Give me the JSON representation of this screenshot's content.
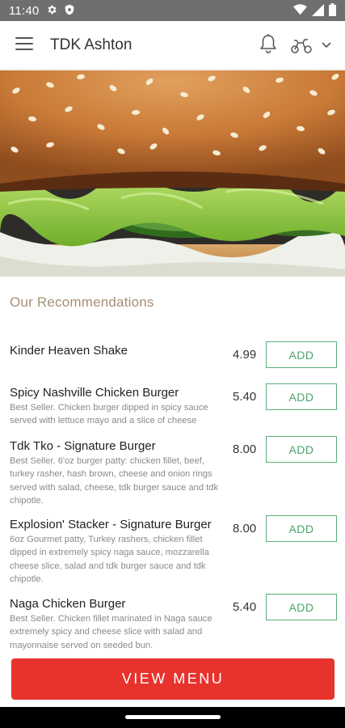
{
  "status_bar": {
    "time": "11:40",
    "icons": [
      "gear-icon",
      "shield-icon",
      "wifi-icon",
      "signal-icon",
      "battery-icon"
    ]
  },
  "app_bar": {
    "title": "TDK Ashton",
    "icons": [
      "menu-icon",
      "bell-icon",
      "scooter-icon",
      "chevron-down-icon"
    ]
  },
  "hero": {
    "image": "burger-photo"
  },
  "recommendations": {
    "title": "Our Recommendations",
    "add_label": "ADD",
    "items": [
      {
        "name": "Kinder Heaven Shake",
        "description": "",
        "price": "4.99"
      },
      {
        "name": "Spicy Nashville Chicken Burger",
        "description": "Best Seller. Chicken burger dipped in spicy sauce served with lettuce mayo and a slice of cheese",
        "price": "5.40"
      },
      {
        "name": "Tdk Tko - Signature Burger",
        "description": "Best Seller. 6'oz burger patty: chicken fillet, beef, turkey rasher, hash brown, cheese and onion rings served with salad, cheese, tdk burger sauce and tdk chipotle.",
        "price": "8.00"
      },
      {
        "name": "Explosion' Stacker - Signature Burger",
        "description": "6oz Gourmet patty, Turkey rashers, chicken fillet dipped in extremely spicy naga sauce, mozzarella cheese slice, salad and tdk burger sauce and tdk chipotle.",
        "price": "8.00"
      },
      {
        "name": "Naga Chicken Burger",
        "description": "Best Seller. Chicken fillet marinated in Naga sauce extremely spicy and cheese slice with salad and mayonnaise served on seeded bun.",
        "price": "5.40"
      }
    ]
  },
  "view_menu": {
    "label": "VIEW MENU"
  },
  "colors": {
    "accent_red": "#e8322c",
    "add_green": "#4aa36a",
    "section_title": "#a58f74",
    "status_bar": "#6f6f6f"
  }
}
